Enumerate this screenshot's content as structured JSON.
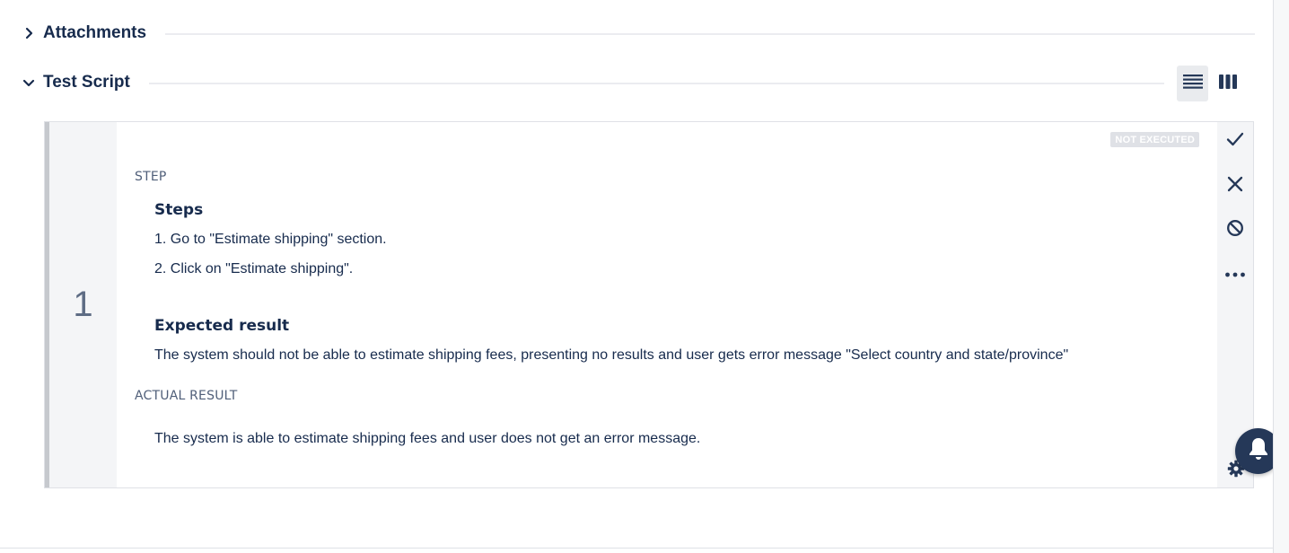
{
  "sections": {
    "attachments": {
      "title": "Attachments",
      "icon": "chevron-right-icon"
    },
    "test_script": {
      "title": "Test Script",
      "icon": "chevron-down-icon"
    }
  },
  "view_toggles": [
    {
      "icon": "list-view-icon",
      "active": true
    },
    {
      "icon": "column-view-icon",
      "active": false
    }
  ],
  "step": {
    "number": "1",
    "status": "NOT EXECUTED",
    "step_label": "STEP",
    "steps_heading": "Steps",
    "steps": [
      "1. Go to \"Estimate shipping\" section.",
      "2. Click on \"Estimate shipping\"."
    ],
    "expected_heading": "Expected result",
    "expected_text": "The system should not be able to estimate shipping fees, presenting no results and user gets error message \"Select country and state/province\"",
    "actual_label": "ACTUAL RESULT",
    "actual_text": "The system is able to estimate shipping fees and user does not get an error message."
  },
  "actions": [
    {
      "icon": "check-icon"
    },
    {
      "icon": "close-icon"
    },
    {
      "icon": "blocked-icon"
    },
    {
      "icon": "more-icon"
    }
  ],
  "colors": {
    "text": "#172b4d",
    "muted": "#5e6c84",
    "badge": "#dfe1e6",
    "bell": "#253858"
  }
}
